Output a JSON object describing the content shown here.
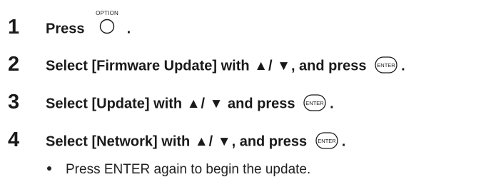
{
  "steps": [
    {
      "number": "1",
      "text_before": "Press",
      "button_caption": "OPTION",
      "text_after": "."
    },
    {
      "number": "2",
      "text_before": "Select [Firmware Update] with",
      "up_symbol": "▲",
      "separator": "/",
      "down_symbol": "▼",
      "text_mid": ", and press",
      "button_label": "ENTER",
      "text_after": "."
    },
    {
      "number": "3",
      "text_before": "Select [Update] with",
      "up_symbol": "▲",
      "separator": "/",
      "down_symbol": "▼",
      "text_mid": "and press",
      "button_label": "ENTER",
      "text_after": "."
    },
    {
      "number": "4",
      "text_before": "Select [Network] with",
      "up_symbol": "▲",
      "separator": "/",
      "down_symbol": "▼",
      "text_mid": ", and press",
      "button_label": "ENTER",
      "text_after": "."
    }
  ],
  "note": "Press ENTER again to begin the update.",
  "icons": {
    "option_button": "circle-button-icon",
    "enter_button": "enter-button-icon",
    "up": "up-triangle-icon",
    "down": "down-triangle-icon",
    "bullet": "bullet-icon"
  },
  "colors": {
    "text": "#1a1a1a",
    "background": "#ffffff"
  }
}
